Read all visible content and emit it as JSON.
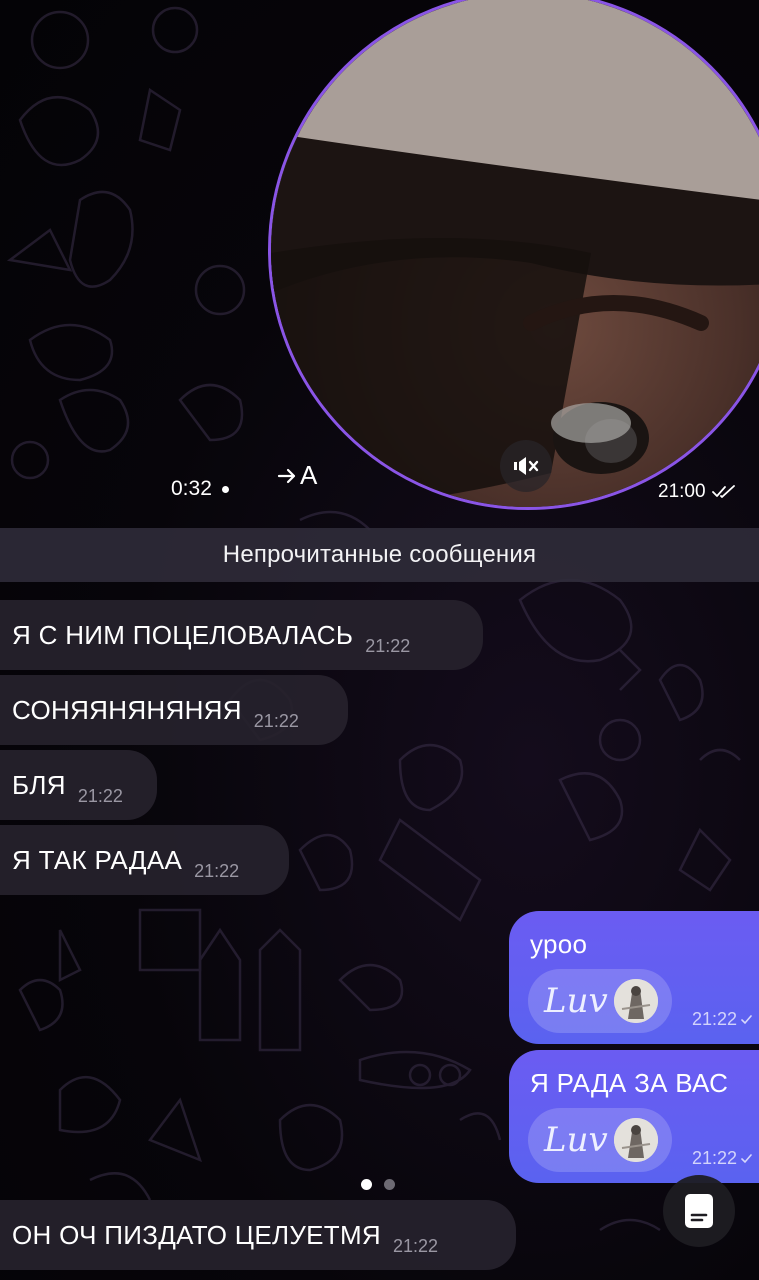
{
  "video_message": {
    "duration": "0:32",
    "transcribe_label": "A",
    "time": "21:00",
    "status": "read",
    "muted": true
  },
  "unread_divider": "Непрочитанные сообщения",
  "incoming_messages": [
    {
      "text": "Я С НИМ ПОЦЕЛОВАЛАСЬ",
      "time": "21:22"
    },
    {
      "text": "СОНЯЯНЯНЯНЯЯ",
      "time": "21:22"
    },
    {
      "text": "БЛЯ",
      "time": "21:22"
    },
    {
      "text": "Я ТАК РАДАА",
      "time": "21:22"
    }
  ],
  "outgoing_messages": [
    {
      "text": "уроо",
      "time": "21:22",
      "reaction": "Luv"
    },
    {
      "text": "Я РАДА ЗА ВАС",
      "time": "21:22",
      "reaction": "Luv"
    }
  ],
  "last_message": {
    "text": "ОН ОЧ ПИЗДАТО ЦЕЛУЕТМЯ",
    "time": "21:22"
  },
  "pager": {
    "count": 2,
    "active": 1
  },
  "colors": {
    "accent_outgoing": "#6b5cf2",
    "video_ring": "#8a55e6",
    "incoming_bubble": "#26222c"
  },
  "icons": {
    "mute": "speaker-muted-icon",
    "transcribe": "arrow-right-icon",
    "read": "double-check-icon",
    "doc": "document-icon"
  }
}
